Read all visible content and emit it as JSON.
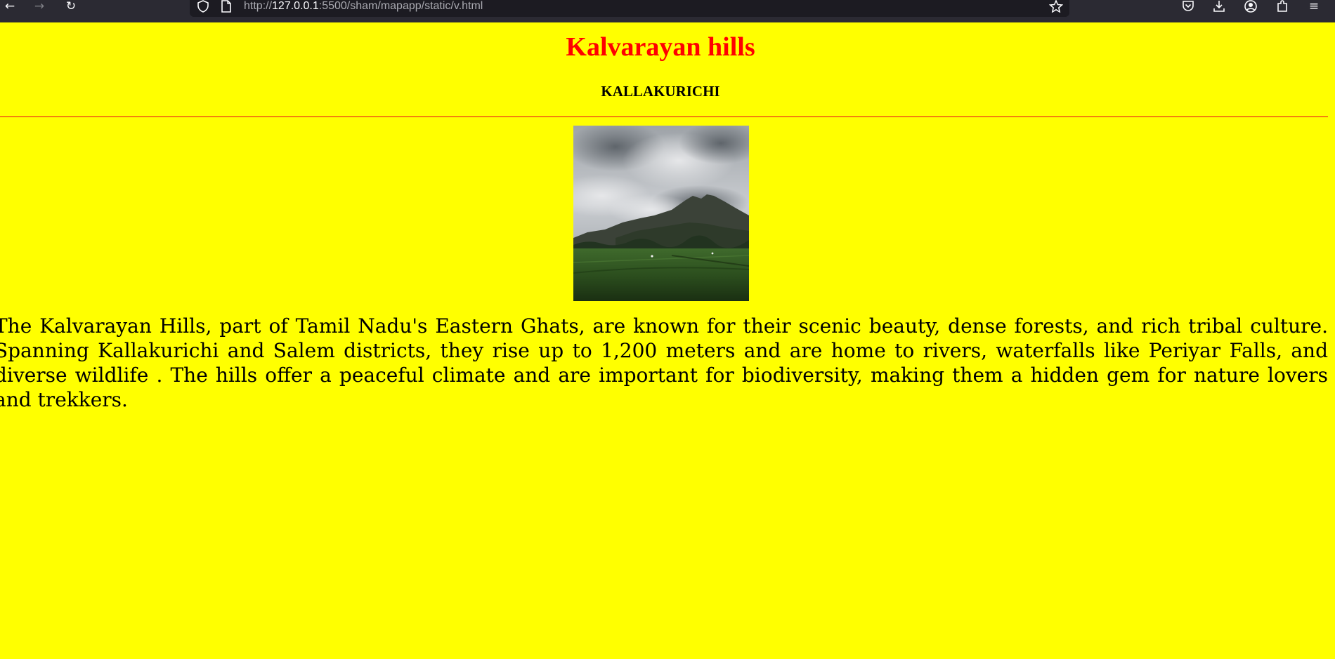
{
  "browser": {
    "url_prefix": "http://",
    "url_host": "127.0.0.1",
    "url_rest": ":5500/sham/mapapp/static/v.html",
    "icons": {
      "back": "back-arrow-icon",
      "forward": "forward-arrow-icon",
      "reload": "reload-icon",
      "shield": "shield-icon",
      "page": "page-icon",
      "bookmark": "star-icon",
      "pocket": "pocket-icon",
      "downloads": "download-icon",
      "account": "account-icon",
      "extensions": "extensions-icon",
      "menu": "hamburger-menu-icon"
    }
  },
  "page": {
    "title": "Kalvarayan hills",
    "subtitle": "KALLAKURICHI",
    "description": "The Kalvarayan Hills, part of Tamil Nadu's Eastern Ghats, are known for their scenic beauty, dense forests, and rich tribal culture. Spanning Kallakurichi and Salem districts, they rise up to 1,200 meters and are home to rivers, waterfalls like Periyar Falls, and diverse wildlife . The hills offer a peaceful climate and are important for biodiversity, making them a hidden gem for nature lovers and trekkers."
  },
  "colors": {
    "background": "#ffff00",
    "title": "#ff0000",
    "rule": "#e8001c"
  }
}
